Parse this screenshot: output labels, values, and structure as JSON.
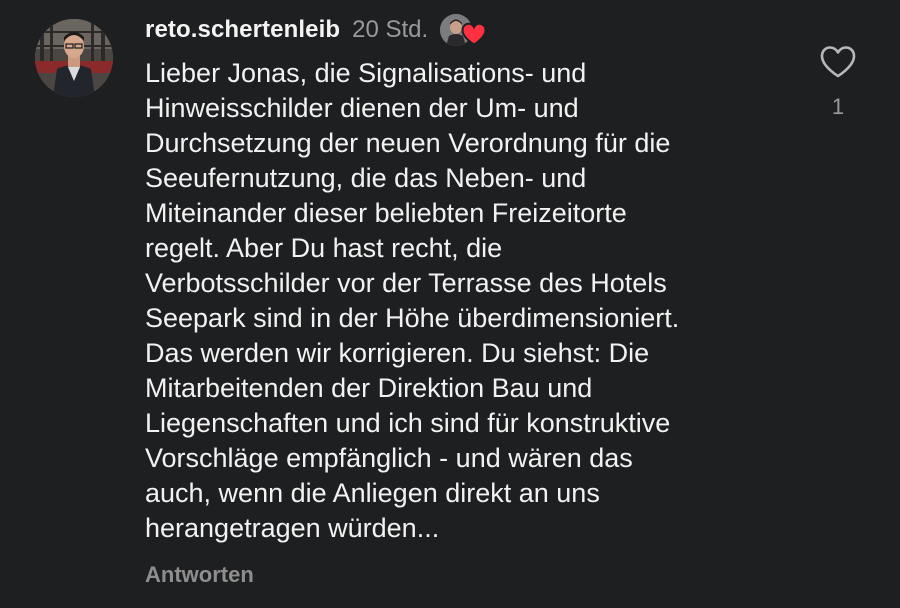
{
  "comment": {
    "username": "reto.schertenleib",
    "time": "20 Std.",
    "text": "Lieber Jonas, die Signalisations- und\nHinweisschilder dienen der Um- und\nDurchsetzung der neuen Verordnung für die\nSeeufernutzung, die das Neben- und\nMiteinander dieser beliebten Freizeitorte\nregelt. Aber Du hast recht, die\nVerbotsschilder vor der Terrasse des Hotels\nSeepark sind in der Höhe überdimensioniert.\nDas werden wir korrigieren. Du siehst: Die\nMitarbeitenden der Direktion Bau und\nLiegenschaften und ich sind für konstruktive\nVorschläge empfänglich - und wären das\nauch, wenn die Anliegen direkt an uns\nherangetragen würden...",
    "reply_label": "Antworten",
    "like_count": "1",
    "liked_by_creator": true
  },
  "icons": {
    "like": "heart-outline-icon",
    "creator_like": "heart-filled-icon"
  },
  "colors": {
    "background": "#1e1f21",
    "text": "#f2f2f2",
    "muted": "#9a9a9a",
    "heart_red": "#ff3040"
  }
}
